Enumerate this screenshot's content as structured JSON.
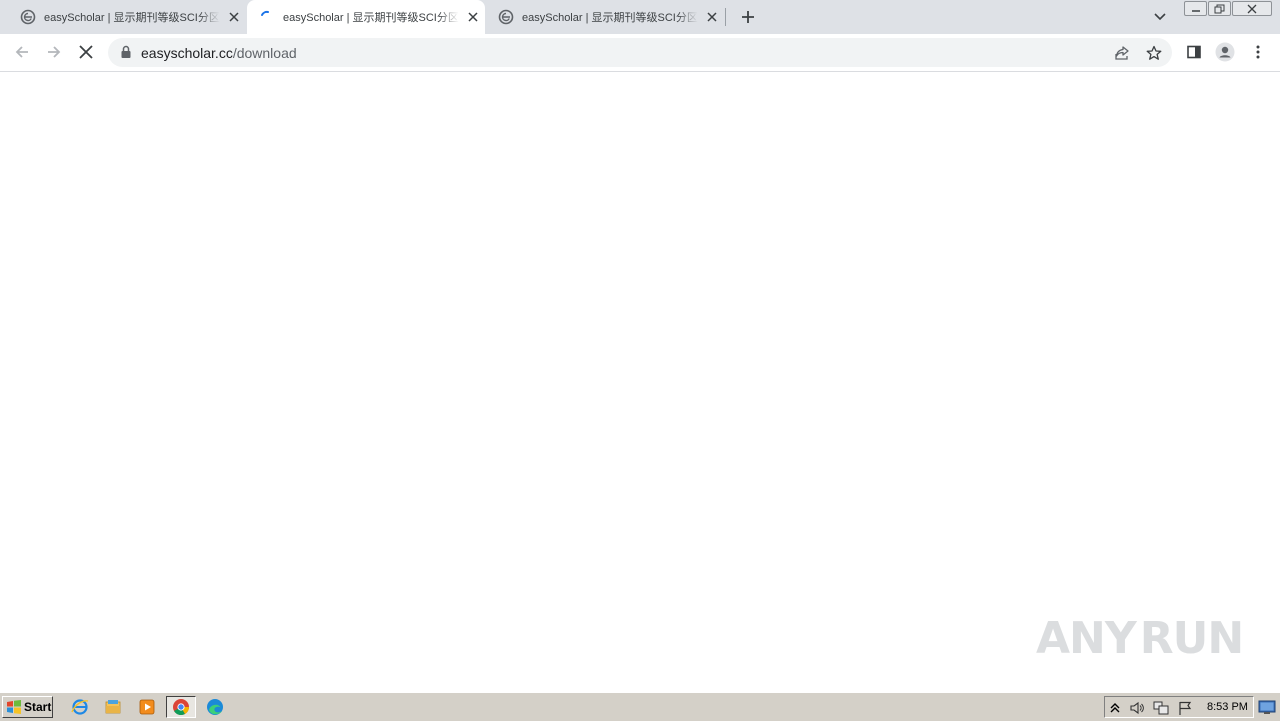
{
  "browser": {
    "tabs": [
      {
        "title": "easyScholar | 显示期刊等级SCI分区",
        "state": "loaded",
        "favicon": "easyscholar-favicon"
      },
      {
        "title": "easyScholar | 显示期刊等级SCI分区",
        "state": "loading",
        "favicon": "loading-spinner"
      },
      {
        "title": "easyScholar | 显示期刊等级SCI分区",
        "state": "loaded",
        "favicon": "easyscholar-favicon"
      }
    ],
    "active_tab_index": 1,
    "address": {
      "domain": "easyscholar.cc",
      "path": "/download"
    },
    "icons": {
      "back": "back-arrow-icon",
      "forward": "forward-arrow-icon",
      "stop": "stop-loading-icon",
      "lock": "lock-icon",
      "share": "share-icon",
      "bookmark": "star-icon",
      "side_panel": "side-panel-icon",
      "profile": "profile-icon",
      "menu": "kebab-menu-icon"
    }
  },
  "watermark": {
    "left": "ANY",
    "right": "RUN"
  },
  "taskbar": {
    "start_label": "Start",
    "pinned": [
      "internet-explorer-icon",
      "windows-explorer-icon",
      "media-player-icon",
      "chrome-icon",
      "edge-icon"
    ],
    "clock": "8:53 PM"
  },
  "colors": {
    "tabstrip": "#dee1e6",
    "omnibox": "#f1f3f4",
    "taskbar": "#d4d0c8",
    "spinner": "#1a73e8"
  }
}
